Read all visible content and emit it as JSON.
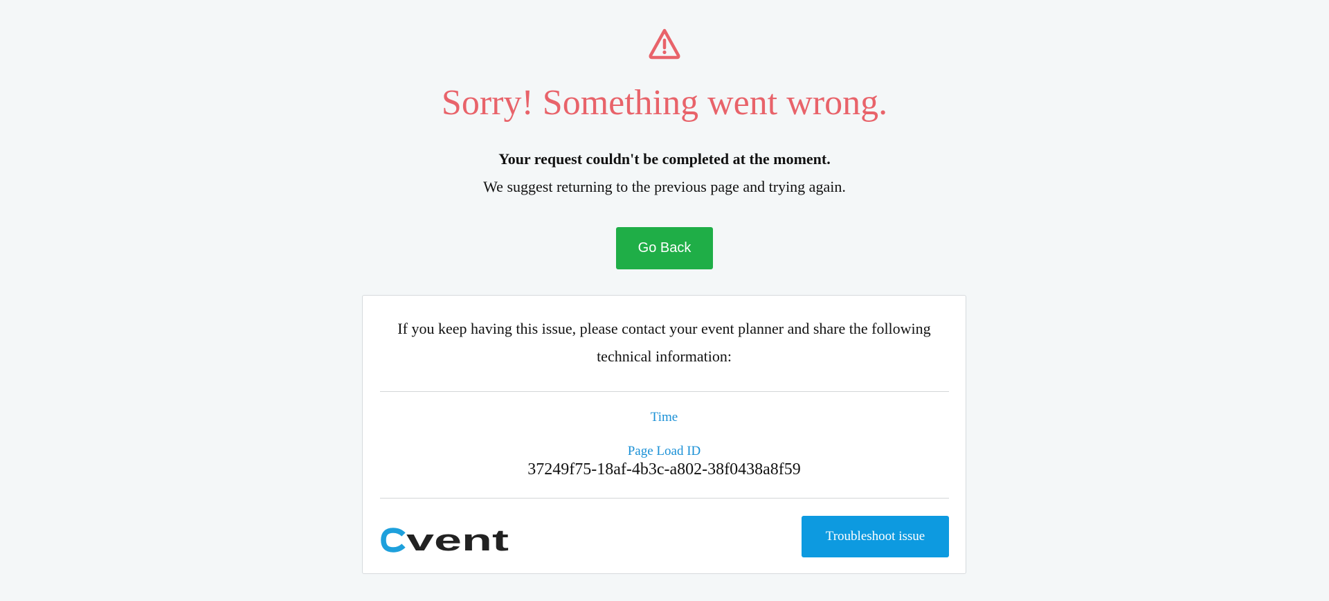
{
  "error": {
    "icon": "warning-triangle-icon",
    "title": "Sorry! Something went wrong.",
    "subtitle": "Your request couldn't be completed at the moment.",
    "suggestion": "We suggest returning to the previous page and trying again.",
    "go_back_label": "Go Back"
  },
  "card": {
    "info_text": "If you keep having this issue, please contact your event planner and share the following technical information:",
    "time_label": "Time",
    "page_load_id_label": "Page Load ID",
    "page_load_id_value": "37249f75-18af-4b3c-a802-38f0438a8f59",
    "logo_text": "cvent",
    "troubleshoot_label": "Troubleshoot issue"
  },
  "colors": {
    "background": "#f4f7f8",
    "error_accent": "#e8636a",
    "go_back_button": "#1fae47",
    "link_label": "#1a90d6",
    "troubleshoot_button": "#0d9ae0",
    "logo_c": "#1ea0dc",
    "logo_text": "#222222"
  }
}
